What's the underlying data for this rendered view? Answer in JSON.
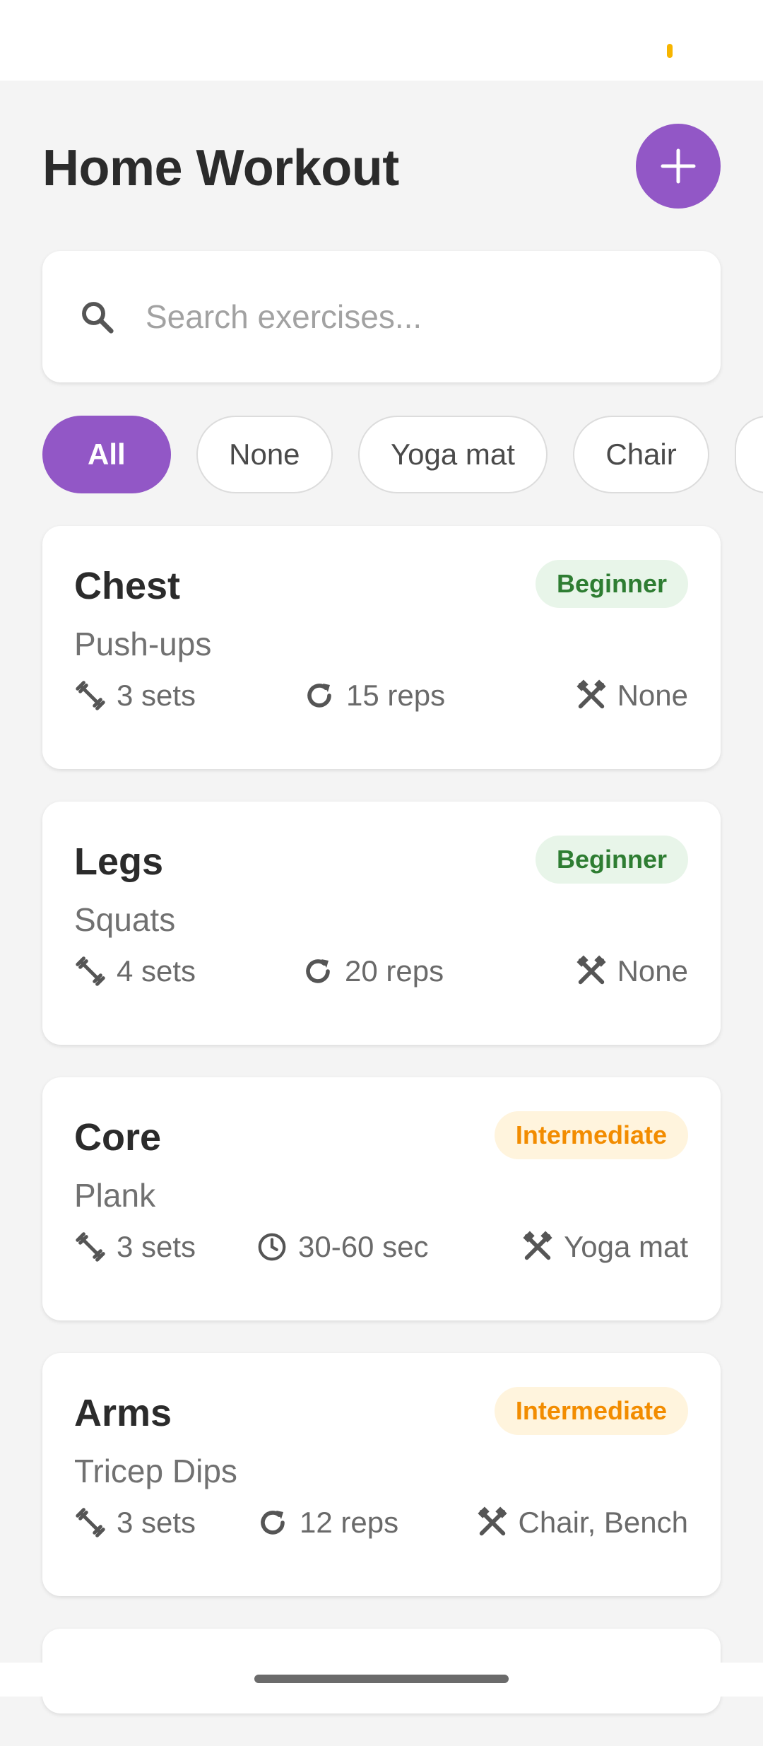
{
  "header": {
    "title": "Home Workout",
    "add_icon": "plus-icon"
  },
  "search": {
    "placeholder": "Search exercises...",
    "value": "",
    "icon": "search-icon"
  },
  "filters": {
    "chips": [
      {
        "label": "All",
        "active": true
      },
      {
        "label": "None",
        "active": false
      },
      {
        "label": "Yoga mat",
        "active": false
      },
      {
        "label": "Chair",
        "active": false
      },
      {
        "label": "",
        "active": false
      }
    ]
  },
  "colors": {
    "accent": "#9257c6",
    "beginner_text": "#2e7d32",
    "beginner_bg": "#e8f5e9",
    "intermediate_text": "#f28c00",
    "intermediate_bg": "#fff4dd"
  },
  "exercises": [
    {
      "muscle": "Chest",
      "name": "Push-ups",
      "level": "Beginner",
      "sets": "3 sets",
      "amount_icon": "repeat-icon",
      "amount": "15 reps",
      "equipment": "None"
    },
    {
      "muscle": "Legs",
      "name": "Squats",
      "level": "Beginner",
      "sets": "4 sets",
      "amount_icon": "repeat-icon",
      "amount": "20 reps",
      "equipment": "None"
    },
    {
      "muscle": "Core",
      "name": "Plank",
      "level": "Intermediate",
      "sets": "3 sets",
      "amount_icon": "clock-icon",
      "amount": "30-60 sec",
      "equipment": "Yoga mat"
    },
    {
      "muscle": "Arms",
      "name": "Tricep Dips",
      "level": "Intermediate",
      "sets": "3 sets",
      "amount_icon": "repeat-icon",
      "amount": "12 reps",
      "equipment": "Chair, Bench"
    }
  ]
}
